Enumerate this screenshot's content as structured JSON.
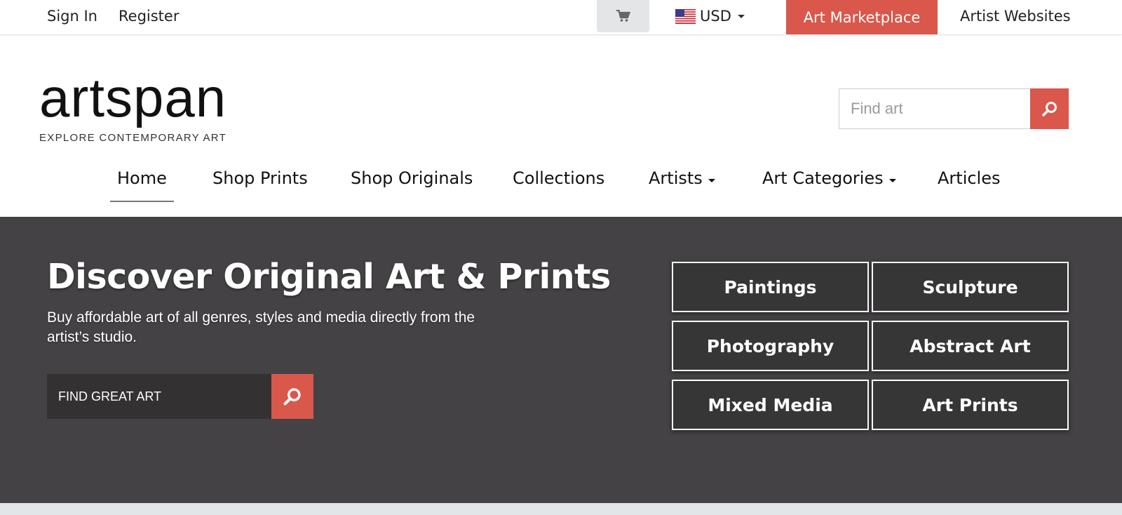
{
  "topbar": {
    "sign_in": "Sign In",
    "register": "Register",
    "currency": "USD",
    "marketplace": "Art Marketplace",
    "artist_websites": "Artist Websites"
  },
  "header": {
    "logo_word": "artspan",
    "logo_tagline": "EXPLORE CONTEMPORARY ART",
    "search_placeholder": "Find art"
  },
  "nav": {
    "items": [
      {
        "label": "Home",
        "active": true
      },
      {
        "label": "Shop Prints"
      },
      {
        "label": "Shop Originals"
      },
      {
        "label": "Collections"
      },
      {
        "label": "Artists",
        "dropdown": true
      },
      {
        "label": "Art Categories",
        "dropdown": true
      },
      {
        "label": "Articles"
      }
    ]
  },
  "hero": {
    "title": "Discover Original Art & Prints",
    "subtitle": "Buy affordable art of all genres, styles and media directly from the artist’s studio.",
    "search_placeholder": "FIND GREAT ART",
    "categories": [
      "Paintings",
      "Sculpture",
      "Photography",
      "Abstract Art",
      "Mixed Media",
      "Art Prints"
    ]
  },
  "icons": {
    "cart": "cart-icon",
    "flag": "us-flag-icon",
    "search": "search-icon"
  },
  "colors": {
    "accent": "#d9574b",
    "hero_bg": "#444244",
    "tile_bg": "#373637"
  }
}
